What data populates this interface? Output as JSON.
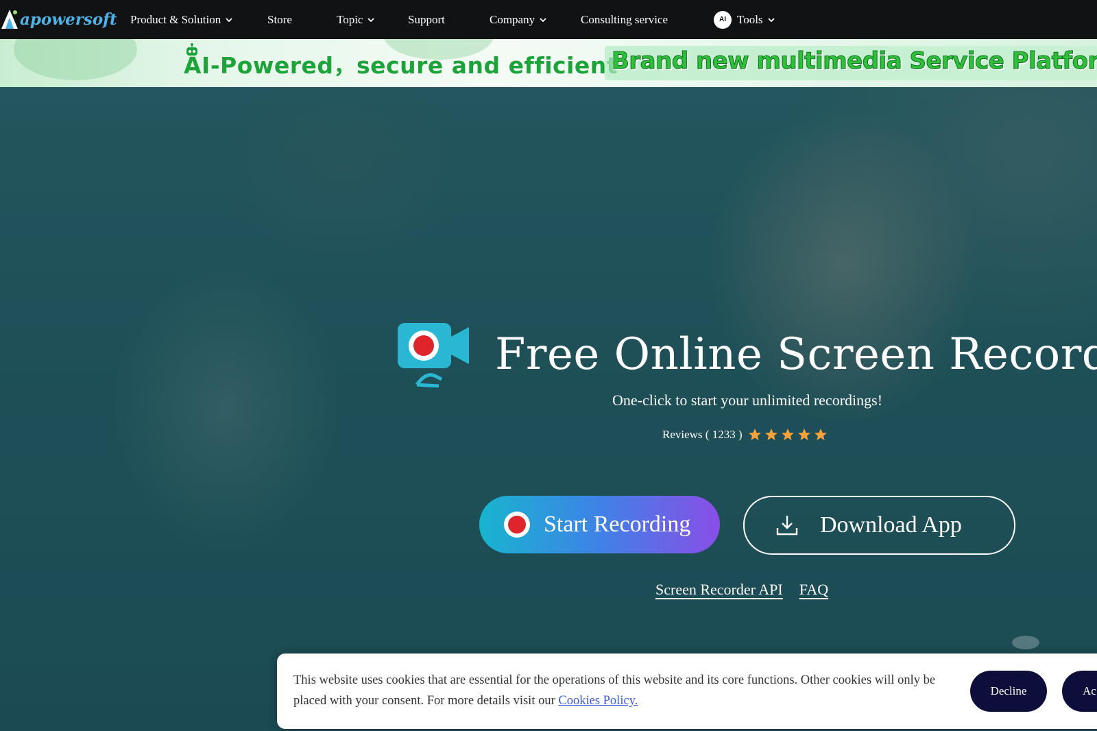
{
  "nav": {
    "logo_text": "apowersoft",
    "items": [
      {
        "label": "Product & Solution",
        "has_dropdown": true
      },
      {
        "label": "Store",
        "has_dropdown": false
      },
      {
        "label": "Topic",
        "has_dropdown": true
      },
      {
        "label": "Support",
        "has_dropdown": false
      },
      {
        "label": "Company",
        "has_dropdown": true
      },
      {
        "label": "Consulting service",
        "has_dropdown": false
      },
      {
        "label": "Tools",
        "has_dropdown": true,
        "badge": "AI"
      }
    ]
  },
  "banner": {
    "left_text": "AI-Powered，secure and efficient",
    "right_text": "Brand new multimedia Service Platform"
  },
  "hero": {
    "title": "Free Online Screen Recorder",
    "subtitle": "One-click to start your unlimited recordings!",
    "reviews_label": "Reviews ( 1233 )",
    "rating_stars": 5,
    "start_button": "Start Recording",
    "download_button": "Download App",
    "links": [
      "Screen Recorder API",
      "FAQ"
    ]
  },
  "cookie": {
    "text_prefix": "This website uses cookies that are essential for the operations of this website and its core functions. Other cookies will only be placed with your consent. For more details visit our ",
    "policy_link": "Cookies Policy.",
    "decline": "Decline",
    "accept": "Ac"
  },
  "colors": {
    "nav_bg": "#111214",
    "banner_green": "#1ca43a",
    "star": "#f7a23b",
    "record_red": "#e0242b",
    "cookie_button": "#0d0f3a"
  }
}
